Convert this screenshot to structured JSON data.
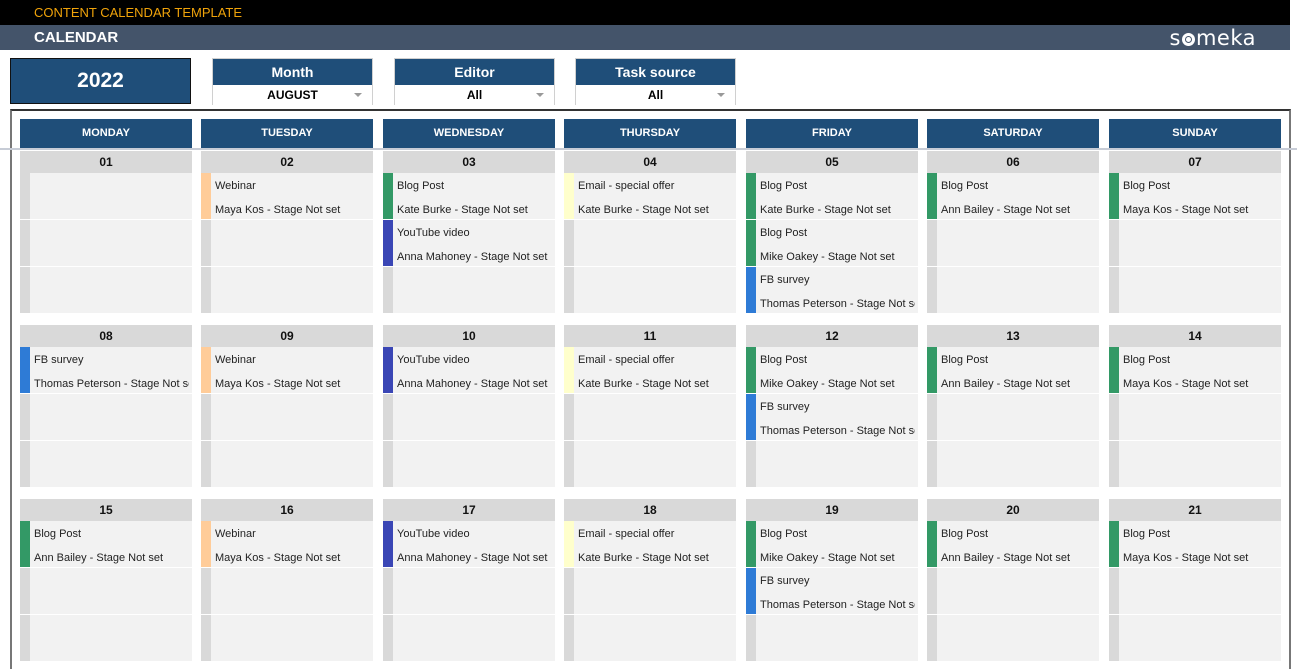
{
  "app": {
    "title": "CONTENT CALENDAR TEMPLATE",
    "section": "CALENDAR",
    "logo": "someka"
  },
  "year": "2022",
  "filters": {
    "month": {
      "label": "Month",
      "value": "AUGUST"
    },
    "editor": {
      "label": "Editor",
      "value": "All"
    },
    "task_source": {
      "label": "Task source",
      "value": "All"
    }
  },
  "colors": {
    "header_blue": "#1f4e79",
    "blog_post": "#339966",
    "webinar": "#ffcc99",
    "youtube_video": "#3a46b5",
    "email": "#ffffcc",
    "fb_survey": "#2e7bd6",
    "empty": "#d9d9d9"
  },
  "weekdays": [
    "MONDAY",
    "TUESDAY",
    "WEDNESDAY",
    "THURSDAY",
    "FRIDAY",
    "SATURDAY",
    "SUNDAY"
  ],
  "weeks": [
    {
      "days": [
        {
          "date": "01",
          "tasks": []
        },
        {
          "date": "02",
          "tasks": [
            {
              "type": "Webinar",
              "detail": "Maya Kos - Stage Not set",
              "color": "#ffcc99"
            }
          ]
        },
        {
          "date": "03",
          "tasks": [
            {
              "type": "Blog Post",
              "detail": "Kate Burke - Stage Not set",
              "color": "#339966"
            },
            {
              "type": "YouTube video",
              "detail": "Anna Mahoney - Stage Not set",
              "color": "#3a46b5"
            }
          ]
        },
        {
          "date": "04",
          "tasks": [
            {
              "type": "Email - special offer",
              "detail": "Kate Burke - Stage Not set",
              "color": "#ffffcc"
            }
          ]
        },
        {
          "date": "05",
          "tasks": [
            {
              "type": "Blog Post",
              "detail": "Kate Burke - Stage Not set",
              "color": "#339966"
            },
            {
              "type": "Blog Post",
              "detail": "Mike Oakey - Stage Not set",
              "color": "#339966"
            },
            {
              "type": "FB survey",
              "detail": "Thomas Peterson - Stage Not set",
              "color": "#2e7bd6"
            }
          ]
        },
        {
          "date": "06",
          "tasks": [
            {
              "type": "Blog Post",
              "detail": "Ann Bailey - Stage Not set",
              "color": "#339966"
            }
          ]
        },
        {
          "date": "07",
          "tasks": [
            {
              "type": "Blog Post",
              "detail": "Maya Kos - Stage Not set",
              "color": "#339966"
            }
          ]
        }
      ]
    },
    {
      "days": [
        {
          "date": "08",
          "tasks": [
            {
              "type": "FB survey",
              "detail": "Thomas Peterson - Stage Not set",
              "color": "#2e7bd6"
            }
          ]
        },
        {
          "date": "09",
          "tasks": [
            {
              "type": "Webinar",
              "detail": "Maya Kos - Stage Not set",
              "color": "#ffcc99"
            }
          ]
        },
        {
          "date": "10",
          "tasks": [
            {
              "type": "YouTube video",
              "detail": "Anna Mahoney - Stage Not set",
              "color": "#3a46b5"
            }
          ]
        },
        {
          "date": "11",
          "tasks": [
            {
              "type": "Email - special offer",
              "detail": "Kate Burke - Stage Not set",
              "color": "#ffffcc"
            }
          ]
        },
        {
          "date": "12",
          "tasks": [
            {
              "type": "Blog Post",
              "detail": "Mike Oakey - Stage Not set",
              "color": "#339966"
            },
            {
              "type": "FB survey",
              "detail": "Thomas Peterson - Stage Not set",
              "color": "#2e7bd6"
            }
          ]
        },
        {
          "date": "13",
          "tasks": [
            {
              "type": "Blog Post",
              "detail": "Ann Bailey - Stage Not set",
              "color": "#339966"
            }
          ]
        },
        {
          "date": "14",
          "tasks": [
            {
              "type": "Blog Post",
              "detail": "Maya Kos - Stage Not set",
              "color": "#339966"
            }
          ]
        }
      ]
    },
    {
      "days": [
        {
          "date": "15",
          "tasks": [
            {
              "type": "Blog Post",
              "detail": "Ann Bailey - Stage Not set",
              "color": "#339966"
            }
          ]
        },
        {
          "date": "16",
          "tasks": [
            {
              "type": "Webinar",
              "detail": "Maya Kos - Stage Not set",
              "color": "#ffcc99"
            }
          ]
        },
        {
          "date": "17",
          "tasks": [
            {
              "type": "YouTube video",
              "detail": "Anna Mahoney - Stage Not set",
              "color": "#3a46b5"
            }
          ]
        },
        {
          "date": "18",
          "tasks": [
            {
              "type": "Email - special offer",
              "detail": "Kate Burke - Stage Not set",
              "color": "#ffffcc"
            }
          ]
        },
        {
          "date": "19",
          "tasks": [
            {
              "type": "Blog Post",
              "detail": "Mike Oakey - Stage Not set",
              "color": "#339966"
            },
            {
              "type": "FB survey",
              "detail": "Thomas Peterson - Stage Not set",
              "color": "#2e7bd6"
            }
          ]
        },
        {
          "date": "20",
          "tasks": [
            {
              "type": "Blog Post",
              "detail": "Ann Bailey - Stage Not set",
              "color": "#339966"
            }
          ]
        },
        {
          "date": "21",
          "tasks": [
            {
              "type": "Blog Post",
              "detail": "Maya Kos - Stage Not set",
              "color": "#339966"
            }
          ]
        }
      ]
    }
  ]
}
